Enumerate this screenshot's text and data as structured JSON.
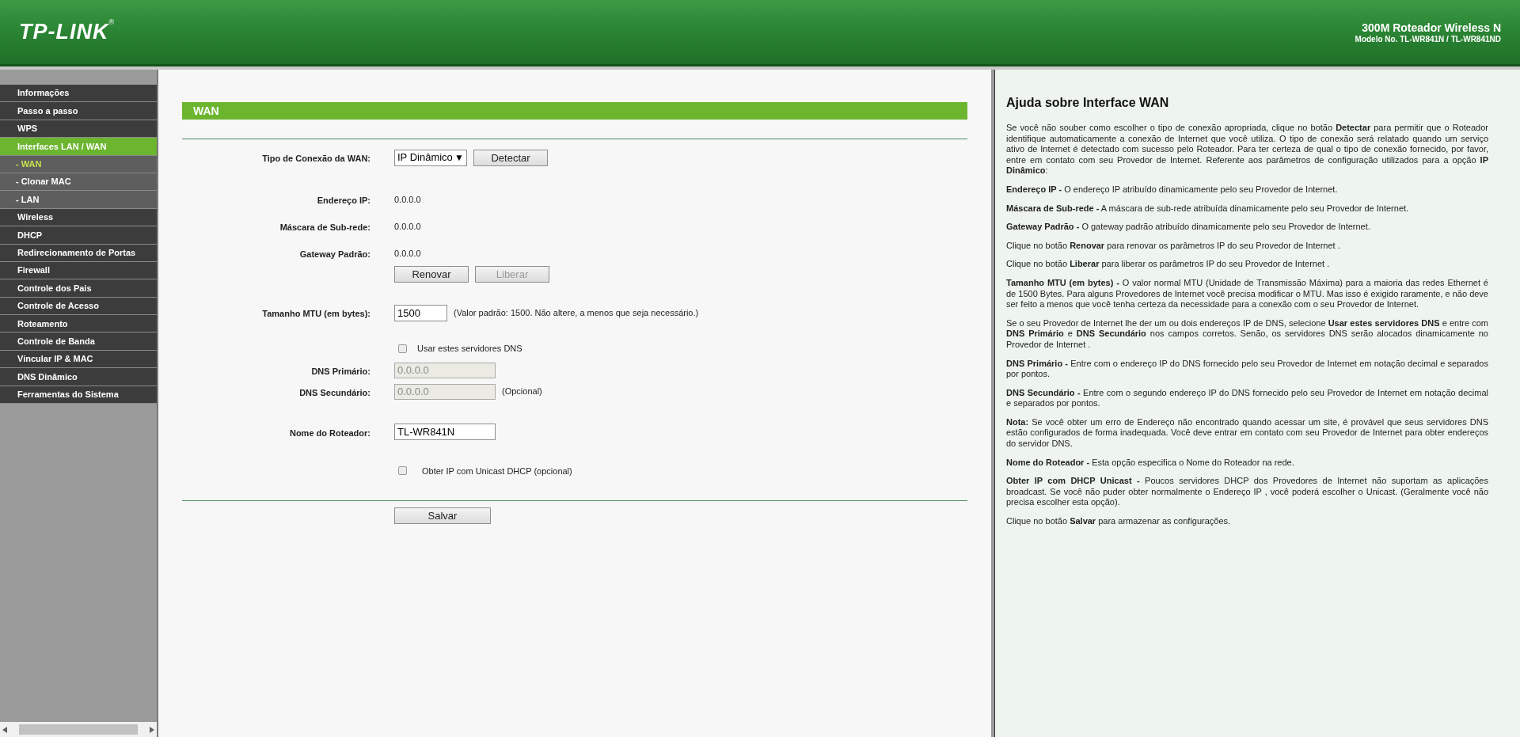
{
  "header": {
    "logo": "TP-LINK",
    "logo_mark": "®",
    "product": "300M Roteador Wireless N",
    "model": "Modelo No. TL-WR841N / TL-WR841ND"
  },
  "sidebar": {
    "items": [
      {
        "label": "Informações",
        "selected": false
      },
      {
        "label": "Passo a passo",
        "selected": false
      },
      {
        "label": "WPS",
        "selected": false
      },
      {
        "label": "Interfaces LAN / WAN",
        "selected": true,
        "children": [
          {
            "label": "- WAN",
            "selected": true
          },
          {
            "label": "- Clonar MAC",
            "selected": false
          },
          {
            "label": "- LAN",
            "selected": false
          }
        ]
      },
      {
        "label": "Wireless",
        "selected": false
      },
      {
        "label": "DHCP",
        "selected": false
      },
      {
        "label": "Redirecionamento de Portas",
        "selected": false
      },
      {
        "label": "Firewall",
        "selected": false
      },
      {
        "label": "Controle dos Pais",
        "selected": false
      },
      {
        "label": "Controle de Acesso",
        "selected": false
      },
      {
        "label": "Roteamento",
        "selected": false
      },
      {
        "label": "Controle de Banda",
        "selected": false
      },
      {
        "label": "Vincular IP & MAC",
        "selected": false
      },
      {
        "label": "DNS Dinâmico",
        "selected": false
      },
      {
        "label": "Ferramentas do Sistema",
        "selected": false
      }
    ]
  },
  "form": {
    "title": "WAN",
    "connection_type": {
      "label": "Tipo de Conexão da WAN:",
      "value": "IP Dinâmico",
      "caret": "▼",
      "button": "Detectar"
    },
    "status": [
      {
        "label": "Endereço IP:",
        "value": "0.0.0.0"
      },
      {
        "label": "Máscara de Sub-rede:",
        "value": "0.0.0.0"
      },
      {
        "label": "Gateway Padrão:",
        "value": "0.0.0.0"
      }
    ],
    "status_buttons": [
      {
        "label": "Renovar",
        "disabled": false
      },
      {
        "label": "Liberar",
        "disabled": true
      }
    ],
    "mtu": {
      "label": "Tamanho MTU (em bytes):",
      "value": "1500",
      "note": "(Valor padrão: 1500. Não altere, a menos que seja necessário.)"
    },
    "use_dns": {
      "label": "Usar estes servidores DNS",
      "checked": false
    },
    "dns": [
      {
        "label": "DNS Primário:",
        "value": "0.0.0.0",
        "disabled": true
      },
      {
        "label": "DNS Secundário:",
        "value": "0.0.0.0",
        "disabled": true,
        "note": "(Opcional)"
      }
    ],
    "router_name": {
      "label": "Nome do Roteador:",
      "value": "TL-WR841N"
    },
    "unicast": {
      "label": "Obter IP com Unicast DHCP (opcional)",
      "checked": false
    },
    "save_button": "Salvar"
  },
  "help": {
    "title": "Ajuda sobre Interface WAN",
    "paragraphs": [
      "Se você não souber como escolher o tipo de conexão apropriada, clique no botão **Detectar** para permitir que o Roteador identifique automaticamente a conexão de Internet que você utiliza. O tipo de conexão será relatado quando um serviço ativo de Internet é detectado com sucesso pelo Roteador. Para ter certeza de qual o tipo de conexão fornecido, por favor, entre em contato com seu Provedor de Internet. Referente aos parâmetros de configuração utilizados para a opção **IP Dinâmico**:",
      "**Endereço IP -** O endereço IP atribuído dinamicamente pelo seu Provedor de Internet.",
      "**Máscara de Sub-rede -** A máscara de sub-rede atribuída dinamicamente pelo seu Provedor de Internet.",
      "**Gateway Padrão -** O gateway padrão atribuído dinamicamente pelo seu Provedor de Internet.",
      "Clique no botão **Renovar** para renovar os parâmetros IP do seu Provedor de Internet .",
      "Clique no botão **Liberar** para liberar os parâmetros IP do seu Provedor de Internet .",
      "**Tamanho MTU (em bytes) -** O valor normal MTU (Unidade de Transmissão Máxima) para a maioria das redes Ethernet é de 1500 Bytes. Para alguns Provedores de Internet você precisa modificar o MTU. Mas isso é exigido raramente, e não deve ser feito a menos que você tenha certeza da necessidade para a conexão com o seu Provedor de Internet.",
      "Se o seu Provedor de Internet lhe der um ou dois endereços IP de DNS, selecione **Usar estes servidores DNS** e entre com **DNS Primário** e **DNS Secundário** nos campos corretos. Senão, os servidores DNS serão alocados dinamicamente no Provedor de Internet .",
      "**DNS Primário -** Entre com o endereço IP do DNS fornecido pelo seu Provedor de Internet em notação decimal e separados por pontos.",
      "**DNS Secundário -** Entre com o segundo endereço IP do DNS fornecido pelo seu Provedor de Internet em notação decimal e separados por pontos.",
      "**Nota:** Se você obter um erro de Endereço não encontrado quando acessar um site, é provável que seus servidores DNS estão configurados de forma inadequada. Você deve entrar em contato com seu Provedor de Internet para obter endereços do servidor DNS.",
      "**Nome do Roteador -** Esta opção especifica o Nome do Roteador na rede.",
      "**Obter IP com DHCP Unicast -** Poucos servidores DHCP dos Provedores de Internet não suportam as aplicações broadcast. Se você não puder obter normalmente o Endereço IP , você poderá escolher o Unicast. (Geralmente você não precisa escolher esta opção).",
      "Clique no botão **Salvar** para armazenar as configurações."
    ]
  }
}
